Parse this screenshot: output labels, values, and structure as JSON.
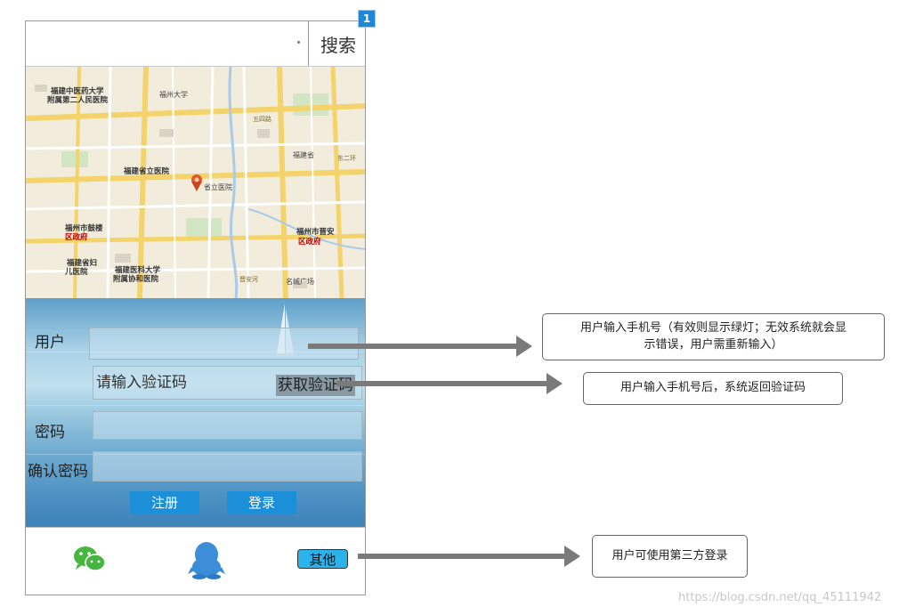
{
  "badge": "1",
  "search": {
    "placeholder": "",
    "button_label": "搜索"
  },
  "map": {
    "labels": [
      {
        "text": "福建中医药大学",
        "cls": "bold"
      },
      {
        "text": "附属第二人民医院",
        "cls": "bold"
      },
      {
        "text": "福建省立医院",
        "cls": "bold"
      },
      {
        "text": "福州市鼓楼",
        "cls": "bold"
      },
      {
        "text": "区政府",
        "cls": "bold red"
      },
      {
        "text": "福州市晋安",
        "cls": "bold"
      },
      {
        "text": "区政府",
        "cls": "bold red"
      },
      {
        "text": "福建省妇",
        "cls": "bold"
      },
      {
        "text": "儿医院",
        "cls": "bold"
      },
      {
        "text": "福建医科大学",
        "cls": "bold"
      },
      {
        "text": "附属协和医院",
        "cls": "bold"
      },
      {
        "text": "晋安河",
        "cls": "road"
      },
      {
        "text": "福州大学",
        "cls": ""
      },
      {
        "text": "省立医院",
        "cls": ""
      },
      {
        "text": "福建省",
        "cls": ""
      },
      {
        "text": "东二环",
        "cls": "road"
      },
      {
        "text": "五四路",
        "cls": "road"
      },
      {
        "text": "名城广场",
        "cls": ""
      }
    ]
  },
  "form": {
    "user_label": "用户",
    "user_value": "",
    "code_placeholder": "请输入验证码",
    "get_code_label": "获取验证码",
    "password_label": "密码",
    "confirm_label": "确认密码",
    "register_label": "注册",
    "login_label": "登录"
  },
  "third_party": {
    "other_label": "其他"
  },
  "notes": {
    "phone_line1": "用户输入手机号（有效则显示绿灯；无效系统就会显",
    "phone_line2": "示错误，用户需重新输入）",
    "code": "用户输入手机号后，系统返回验证码",
    "third": "用户可使用第三方登录"
  },
  "watermark": "https://blog.csdn.net/qq_45111942",
  "colors": {
    "button_blue": "#1b8fd8",
    "other_cyan": "#2bb3ec",
    "wechat_green": "#46b640",
    "qq_blue": "#3d8ed8",
    "arrow_gray": "#7a7a7a"
  }
}
